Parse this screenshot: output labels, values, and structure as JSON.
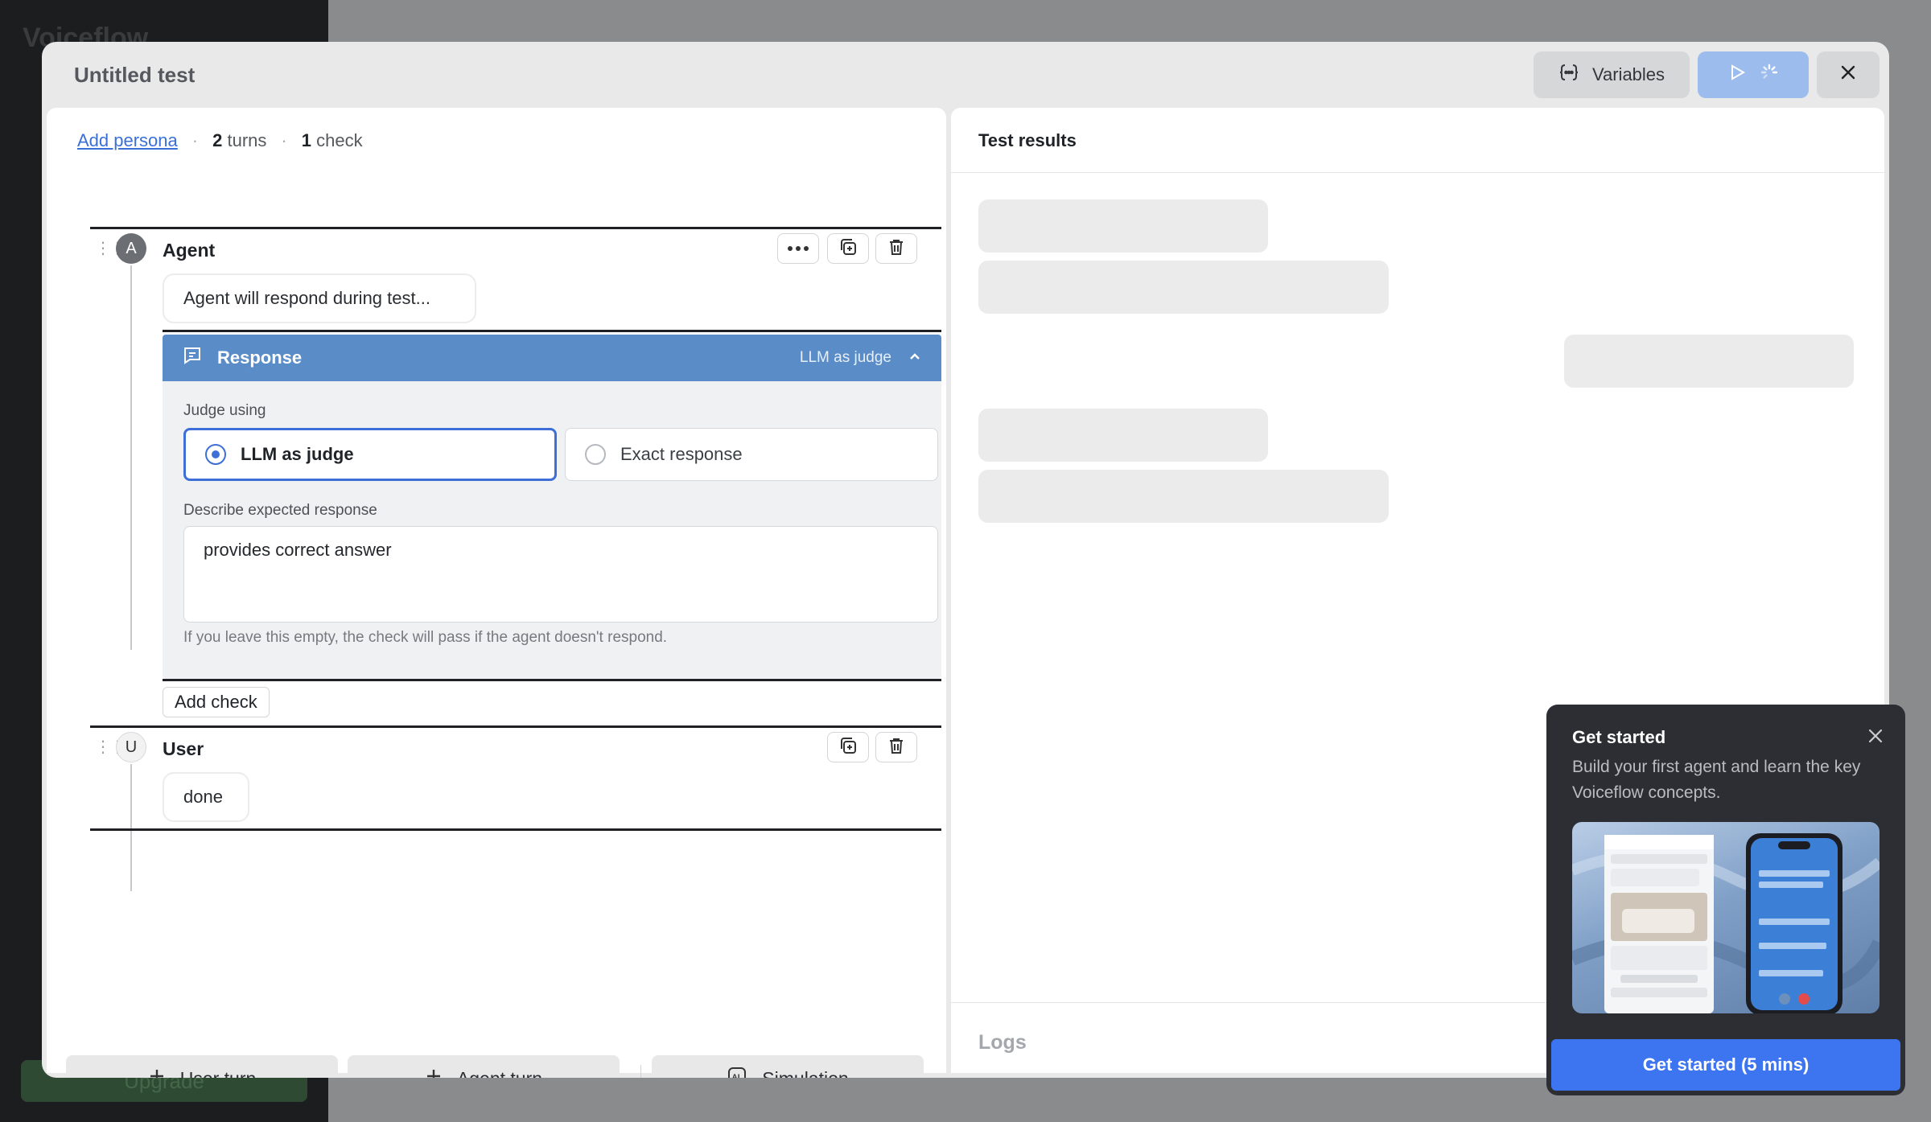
{
  "app": {
    "logo": "Voiceflow",
    "upgrade_label": "Upgrade"
  },
  "modal": {
    "title": "Untitled test",
    "variables_label": "Variables"
  },
  "summary": {
    "add_persona": "Add persona",
    "turns_count": "2",
    "turns_label": "turns",
    "checks_count": "1",
    "checks_label": "check"
  },
  "turns": [
    {
      "role_initial": "A",
      "role": "Agent",
      "message": "Agent will respond during test..."
    },
    {
      "role_initial": "U",
      "role": "User",
      "message": "done"
    }
  ],
  "check": {
    "title": "Response",
    "mode": "LLM as judge",
    "judge_label": "Judge using",
    "options": [
      "LLM as judge",
      "Exact response"
    ],
    "selected_option": "LLM as judge",
    "expected_label": "Describe expected response",
    "expected_value": "provides correct answer",
    "hint": "If you leave this empty, the check will pass if the agent doesn't respond."
  },
  "add_check_label": "Add check",
  "bottom_buttons": {
    "user_turn": "User turn",
    "agent_turn": "Agent turn",
    "simulation": "Simulation"
  },
  "results": {
    "title": "Test results",
    "logs_label": "Logs"
  },
  "get_started": {
    "title": "Get started",
    "body": "Build your first agent and learn the key Voiceflow concepts.",
    "cta": "Get started (5 mins)"
  },
  "colors": {
    "accent": "#3e6fd6",
    "check_header": "#5a8dc7",
    "cta": "#3d74ef"
  }
}
